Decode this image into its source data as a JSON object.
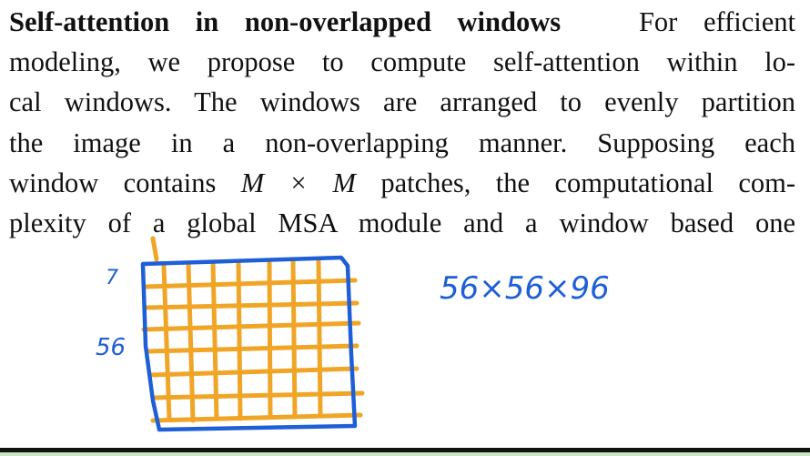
{
  "paragraph": {
    "heading": "Self-attention in non-overlapped windows",
    "lines": [
      "For efficient",
      "modeling, we propose to compute self-attention within lo-",
      "cal windows. The windows are arranged to evenly partition",
      "the image in a non-overlapping manner.  Supposing each"
    ],
    "line5_pre": "window contains ",
    "line5_math": "M × M",
    "line5_post": " patches, the computational com-",
    "line6": "plexity of a global MSA module and a window based one"
  },
  "annotations": {
    "window_size_label": "7",
    "side_label": "56",
    "dimension_label": "56×56×96",
    "grid_color": "#f0a526",
    "ink_color": "#1e5fd6"
  }
}
